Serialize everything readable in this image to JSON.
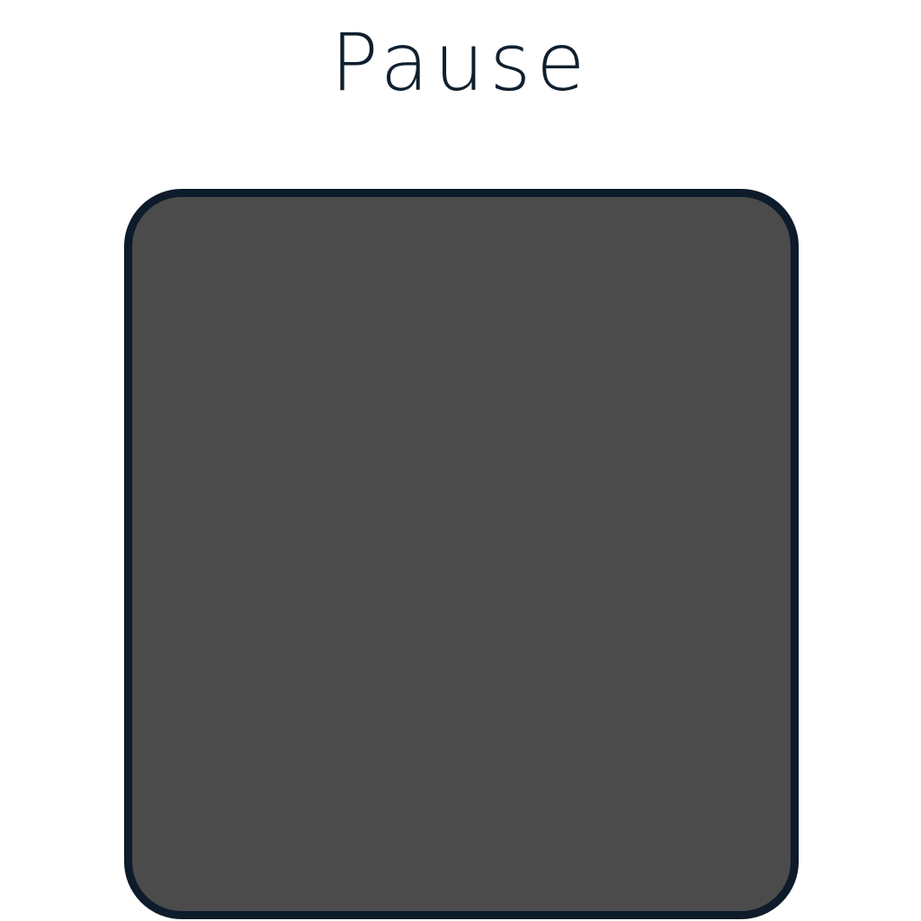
{
  "title": "Pause",
  "colors": {
    "background": "#ffffff",
    "title_text": "#0f1f2e",
    "tile_fill": "#4b4b4b",
    "tile_border": "#0d1b2a"
  }
}
